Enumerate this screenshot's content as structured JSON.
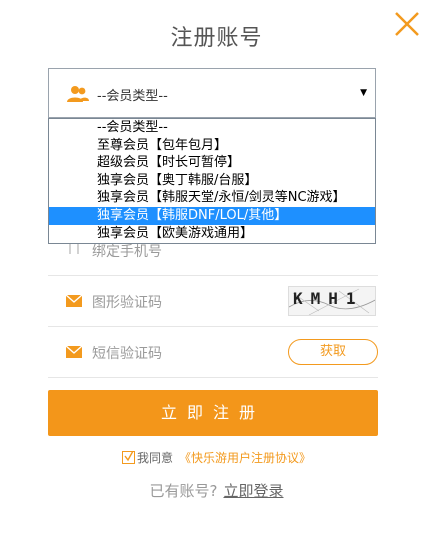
{
  "header": {
    "title": "注册账号"
  },
  "member_select": {
    "selected": "--会员类型--",
    "options": [
      "--会员类型--",
      "至尊会员【包年包月】",
      "超级会员【时长可暂停】",
      "独享会员【奥丁韩服/台服】",
      "独享会员【韩服天堂/永恒/剑灵等NC游戏】",
      "独享会员【韩服DNF/LOL/其他】",
      "独享会员【欧美游戏通用】"
    ],
    "highlighted_index": 5
  },
  "form": {
    "phone_placeholder": "绑定手机号",
    "captcha_label": "图形验证码",
    "captcha_text": "KMH1",
    "sms_label": "短信验证码",
    "get_code_label": "获取"
  },
  "actions": {
    "submit_label": "立即注册",
    "agree_text": "我同意",
    "agreement_link": "《快乐游用户注册协议》",
    "have_account": "已有账号?",
    "login_link": "立即登录"
  },
  "colors": {
    "accent": "#f3961a",
    "highlight": "#1e90ff"
  }
}
